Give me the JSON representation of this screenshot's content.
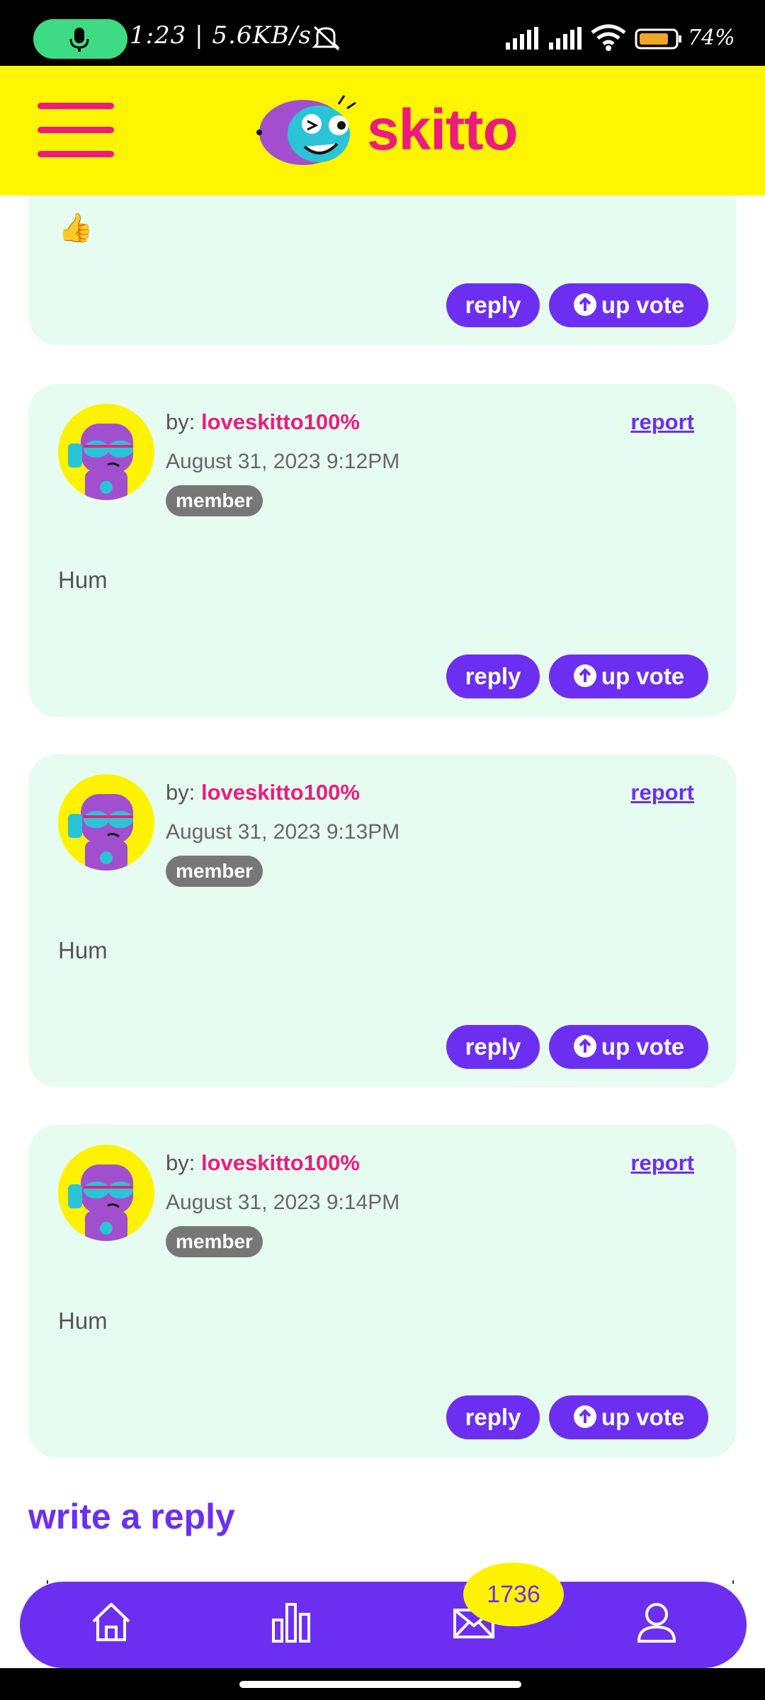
{
  "status_bar": {
    "time_speed": "1:23 | 5.6KB/s",
    "battery_pct": "74%"
  },
  "header": {
    "app_name": "skitto"
  },
  "partial_post": {
    "body_emoji": "👍",
    "reply_label": "reply",
    "upvote_label": "up vote"
  },
  "posts": [
    {
      "by_label": "by:",
      "author": "loveskitto100%",
      "report_label": "report",
      "date": "August 31, 2023 9:12PM",
      "badge": "member",
      "body": "Hum",
      "reply_label": "reply",
      "upvote_label": "up vote"
    },
    {
      "by_label": "by:",
      "author": "loveskitto100%",
      "report_label": "report",
      "date": "August 31, 2023 9:13PM",
      "badge": "member",
      "body": "Hum",
      "reply_label": "reply",
      "upvote_label": "up vote"
    },
    {
      "by_label": "by:",
      "author": "loveskitto100%",
      "report_label": "report",
      "date": "August 31, 2023 9:14PM",
      "badge": "member",
      "body": "Hum",
      "reply_label": "reply",
      "upvote_label": "up vote"
    }
  ],
  "write_reply_heading": "write a reply",
  "bottom_nav": {
    "items": [
      "home-icon",
      "leaderboard-icon",
      "mail-icon",
      "profile-icon"
    ],
    "mail_badge": "1736"
  },
  "colors": {
    "header_bg": "#fff500",
    "brand_pink": "#ec1c7c",
    "accent_purple": "#6c2ff2",
    "card_bg": "#e6fcf0"
  }
}
